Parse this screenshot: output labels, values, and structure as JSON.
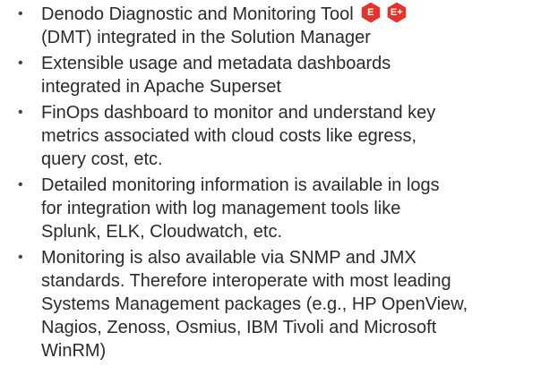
{
  "bullet_glyph": "•",
  "items": [
    {
      "lines": [
        "Denodo Diagnostic and Monitoring Tool",
        "(DMT)  integrated in the Solution Manager"
      ],
      "badges": [
        {
          "label": "E",
          "color": "#e4332a"
        },
        {
          "label": "E+",
          "color": "#e4332a"
        }
      ]
    },
    {
      "lines": [
        "Extensible usage and metadata dashboards",
        "integrated in Apache Superset"
      ]
    },
    {
      "lines": [
        "FinOps dashboard to monitor and understand key",
        "metrics associated with cloud costs like egress,",
        "query cost, etc."
      ]
    },
    {
      "lines": [
        "Detailed monitoring information is available in logs",
        "for integration with log management tools like",
        "Splunk, ELK, Cloudwatch, etc."
      ]
    },
    {
      "lines": [
        "Monitoring is also available via SNMP and JMX",
        "standards. Therefore interoperate with most leading",
        "Systems Management packages (e.g., HP OpenView,",
        "Nagios, Zenoss, Osmius, IBM Tivoli and Microsoft",
        "WinRM)"
      ]
    }
  ]
}
